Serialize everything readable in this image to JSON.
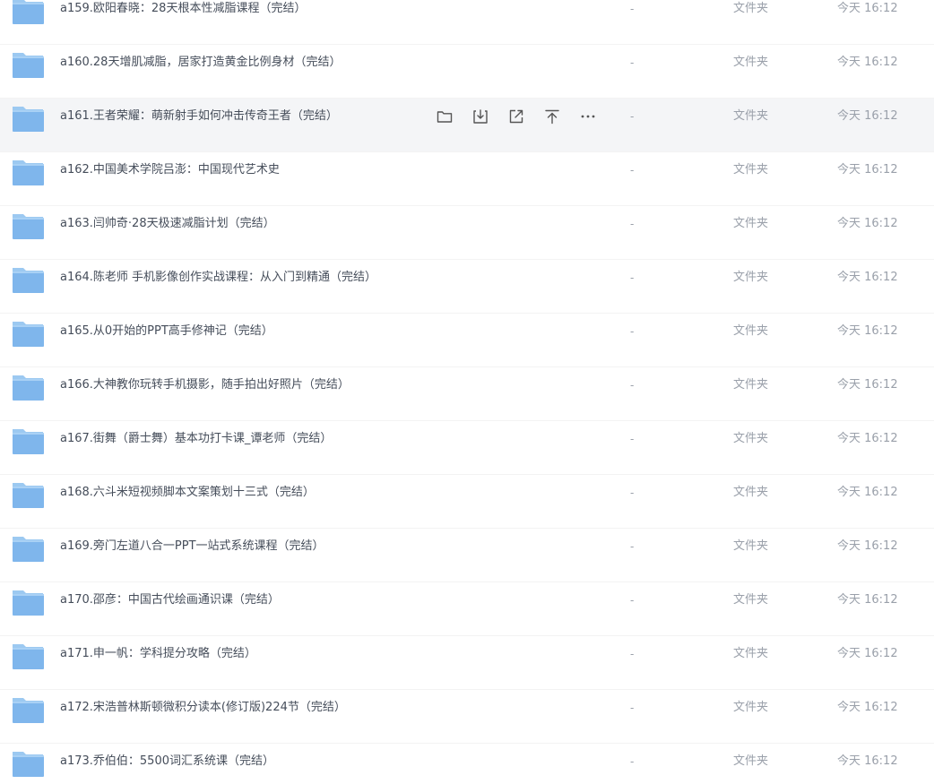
{
  "rows": [
    {
      "name": "a159.欧阳春晓：28天根本性减脂课程（完结）",
      "size": "-",
      "type": "文件夹",
      "time": "今天 16:12"
    },
    {
      "name": "a160.28天增肌减脂，居家打造黄金比例身材（完结）",
      "size": "-",
      "type": "文件夹",
      "time": "今天 16:12"
    },
    {
      "name": "a161.王者荣耀：萌新射手如何冲击传奇王者（完结）",
      "size": "-",
      "type": "文件夹",
      "time": "今天 16:12"
    },
    {
      "name": "a162.中国美术学院吕澎：中国现代艺术史",
      "size": "-",
      "type": "文件夹",
      "time": "今天 16:12"
    },
    {
      "name": "a163.闫帅奇·28天极速减脂计划（完结）",
      "size": "-",
      "type": "文件夹",
      "time": "今天 16:12"
    },
    {
      "name": "a164.陈老师 手机影像创作实战课程：从入门到精通（完结）",
      "size": "-",
      "type": "文件夹",
      "time": "今天 16:12"
    },
    {
      "name": "a165.从0开始的PPT高手修神记（完结）",
      "size": "-",
      "type": "文件夹",
      "time": "今天 16:12"
    },
    {
      "name": "a166.大神教你玩转手机摄影，随手拍出好照片（完结）",
      "size": "-",
      "type": "文件夹",
      "time": "今天 16:12"
    },
    {
      "name": "a167.街舞（爵士舞）基本功打卡课_谭老师（完结）",
      "size": "-",
      "type": "文件夹",
      "time": "今天 16:12"
    },
    {
      "name": "a168.六斗米短视频脚本文案策划十三式（完结）",
      "size": "-",
      "type": "文件夹",
      "time": "今天 16:12"
    },
    {
      "name": "a169.旁门左道八合一PPT一站式系统课程（完结）",
      "size": "-",
      "type": "文件夹",
      "time": "今天 16:12"
    },
    {
      "name": "a170.邵彦：中国古代绘画通识课（完结）",
      "size": "-",
      "type": "文件夹",
      "time": "今天 16:12"
    },
    {
      "name": "a171.申一帆：学科提分攻略（完结）",
      "size": "-",
      "type": "文件夹",
      "time": "今天 16:12"
    },
    {
      "name": "a172.宋浩普林斯顿微积分读本(修订版)224节（完结）",
      "size": "-",
      "type": "文件夹",
      "time": "今天 16:12"
    },
    {
      "name": "a173.乔伯伯：5500词汇系统课（完结）",
      "size": "-",
      "type": "文件夹",
      "time": "今天 16:12"
    }
  ],
  "hover_row_index": 2,
  "hover_actions": [
    "folder-open-icon",
    "download-icon",
    "share-icon",
    "pin-top-icon",
    "more-icon"
  ],
  "colors": {
    "folder": "#7fb6ec",
    "folder_tab": "#a9d1f5",
    "hover_bg": "#f4f5f7",
    "name_text": "#454d5a",
    "meta_text": "#9aa0aa"
  }
}
